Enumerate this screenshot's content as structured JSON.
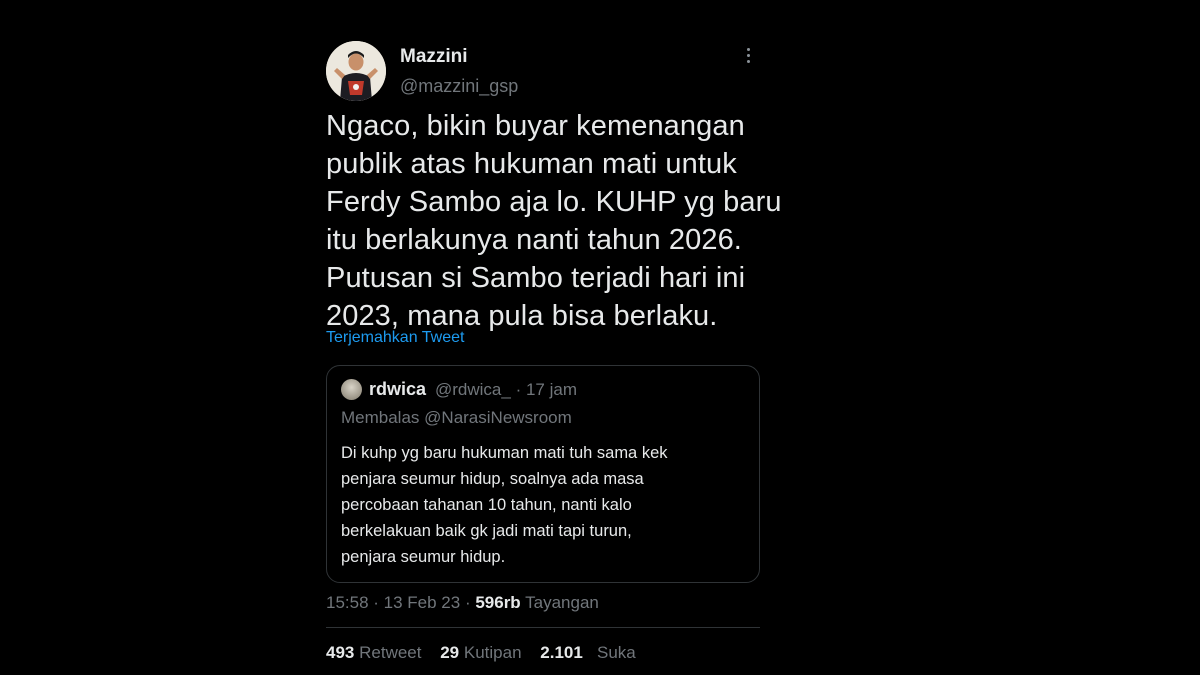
{
  "author": {
    "name": "Mazzini",
    "handle": "@mazzini_gsp"
  },
  "tweet": {
    "lines": [
      "Ngaco, bikin buyar kemenangan",
      "publik atas hukuman mati untuk",
      "Ferdy Sambo aja lo. KUHP yg baru",
      "itu berlakunya nanti tahun 2026.",
      "Putusan si Sambo terjadi hari ini",
      "2023, mana pula bisa berlaku."
    ],
    "translate_label": "Terjemahkan Tweet"
  },
  "quote": {
    "name": "rdwica",
    "handle": "@rdwica_",
    "time": "17 jam",
    "reply_prefix": "Membalas",
    "reply_to": "@NarasiNewsroom",
    "lines": [
      "Di kuhp yg baru hukuman mati tuh sama kek",
      "penjara seumur hidup, soalnya ada masa",
      "percobaan tahanan 10 tahun, nanti kalo",
      "berkelakuan baik gk jadi mati tapi turun,",
      "penjara seumur hidup."
    ]
  },
  "meta": {
    "time": "15:58",
    "date": "13 Feb 23",
    "views_count": "596rb",
    "views_label": "Tayangan"
  },
  "stats": {
    "retweets_count": "493",
    "retweets_label": "Retweet",
    "quotes_count": "29",
    "quotes_label": "Kutipan",
    "likes_count": "2.101",
    "likes_label": "Suka"
  },
  "colors": {
    "background": "#000000",
    "text": "#e7e9ea",
    "secondary": "#71767b",
    "link": "#1d9bf0",
    "border": "#2f3336"
  },
  "icons": [
    "more-options-icon"
  ]
}
